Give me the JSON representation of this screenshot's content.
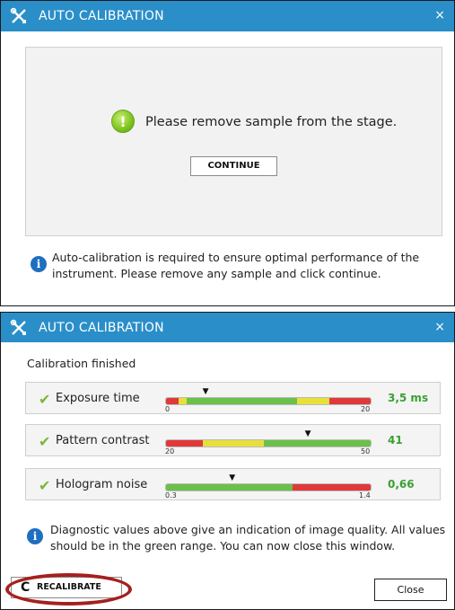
{
  "dialog_top": {
    "title": "AUTO CALIBRATION",
    "close": "×",
    "message": "Please remove sample from the stage.",
    "message_icon": "!",
    "continue_label": "CONTINUE",
    "info": "Auto-calibration is required to ensure optimal performance of the instrument. Please remove any sample and click continue.",
    "info_icon": "i"
  },
  "dialog_bottom": {
    "title": "AUTO CALIBRATION",
    "close": "×",
    "status": "Calibration finished",
    "rows": [
      {
        "label": "Exposure time",
        "min": "0",
        "max": "20",
        "value": "3,5 ms",
        "marker": 0.2
      },
      {
        "label": "Pattern contrast",
        "min": "20",
        "max": "50",
        "value": "41",
        "marker": 0.7
      },
      {
        "label": "Hologram noise",
        "min": "0.3",
        "max": "1.4",
        "value": "0,66",
        "marker": 0.33
      }
    ],
    "check_glyph": "✔",
    "marker_glyph": "▼",
    "info": "Diagnostic values above give an indication of image quality. All values should be in the green range. You can now close this window.",
    "info_icon": "i",
    "recalibrate_label": "RECALIBRATE",
    "refresh_glyph": "C",
    "close_label": "Close"
  },
  "colors": {
    "titlebar": "#2a8ec9",
    "good": "#6cc04a",
    "warn": "#e8e03a",
    "bad": "#e0393a",
    "value": "#3aa032",
    "highlight": "#a5201f"
  }
}
